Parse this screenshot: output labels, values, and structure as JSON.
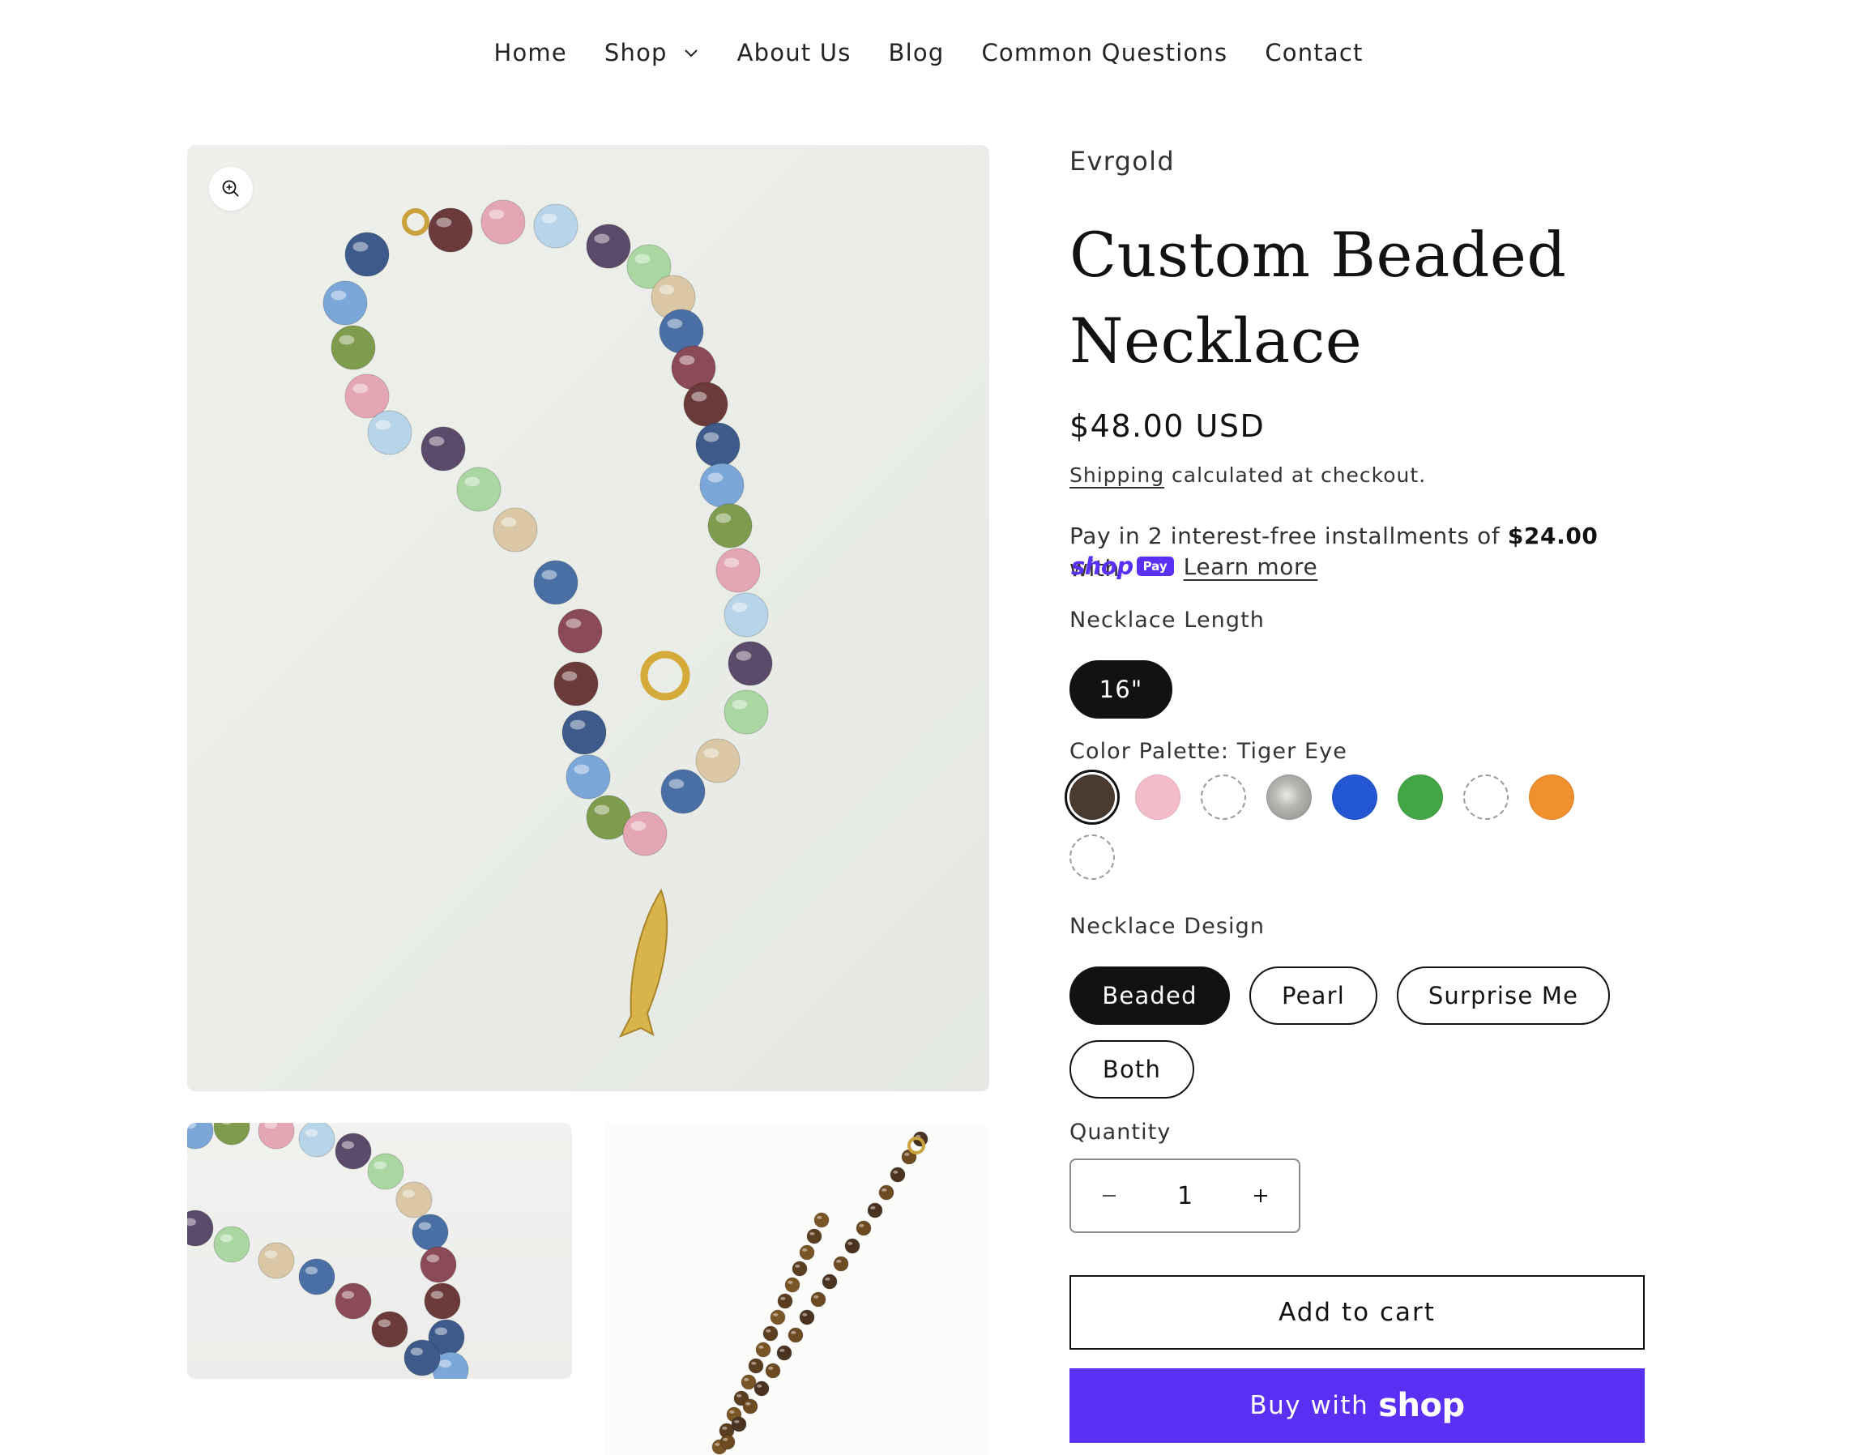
{
  "nav": {
    "items": [
      {
        "label": "Home"
      },
      {
        "label": "Shop",
        "has_dropdown": true
      },
      {
        "label": "About Us"
      },
      {
        "label": "Blog"
      },
      {
        "label": "Common Questions"
      },
      {
        "label": "Contact"
      }
    ]
  },
  "media": {
    "zoom_icon": "zoom-in-icon"
  },
  "product": {
    "vendor": "Evrgold",
    "title": "Custom Beaded Necklace",
    "price": "$48.00 USD",
    "shipping_link": "Shipping",
    "shipping_rest": " calculated at checkout.",
    "installments": {
      "prefix": "Pay in 2 interest-free installments of ",
      "amount": "$24.00",
      "suffix": " with",
      "shop_word": "shop",
      "pay_badge": "Pay",
      "learn_more": "Learn more"
    }
  },
  "options": {
    "length": {
      "label": "Necklace Length",
      "values": [
        "16\""
      ],
      "selected": "16\""
    },
    "color": {
      "label": "Color Palette: Tiger Eye",
      "swatches": [
        {
          "name": "tiger-eye",
          "color": "#4a3b30",
          "selected": true
        },
        {
          "name": "pink",
          "color": "#f4bccb"
        },
        {
          "name": "blank-1",
          "color": "none"
        },
        {
          "name": "grey-pearl",
          "color": "#9a9a96"
        },
        {
          "name": "blue",
          "color": "#2357d1"
        },
        {
          "name": "green",
          "color": "#44a546"
        },
        {
          "name": "blank-2",
          "color": "none"
        },
        {
          "name": "orange",
          "color": "#f0902e"
        },
        {
          "name": "blank-3",
          "color": "none"
        }
      ]
    },
    "design": {
      "label": "Necklace Design",
      "values": [
        "Beaded",
        "Pearl",
        "Surprise Me",
        "Both"
      ],
      "selected": "Beaded"
    }
  },
  "quantity": {
    "label": "Quantity",
    "value": "1",
    "minus": "−",
    "plus": "+"
  },
  "buttons": {
    "add_to_cart": "Add to cart",
    "buy_with": "Buy with",
    "buy_logo": "shop"
  },
  "colors": {
    "accent": "#5a31f4",
    "text": "#121212"
  }
}
